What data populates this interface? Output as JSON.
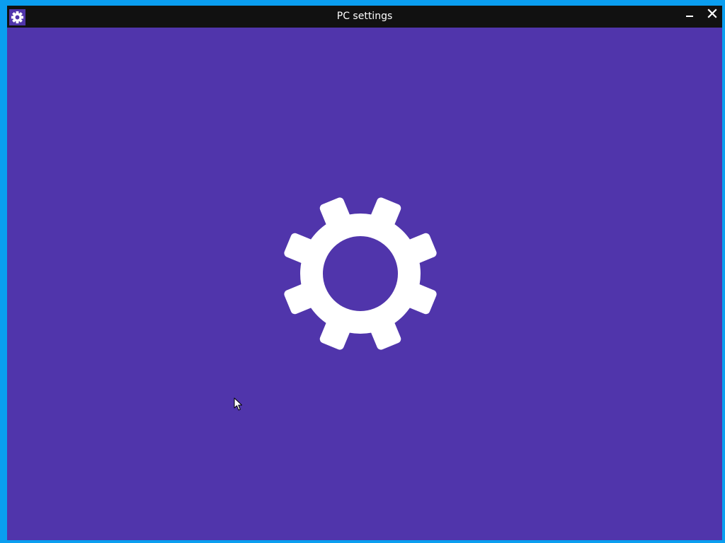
{
  "window": {
    "title": "PC settings",
    "app_icon": "gear-icon",
    "controls": {
      "minimize_icon": "minimize-icon",
      "close_icon": "close-icon"
    }
  },
  "splash": {
    "icon": "gear-icon"
  },
  "colors": {
    "accent": "#5035ab",
    "titlebar": "#111111",
    "desktop": "#0a9ef0",
    "icon": "#ffffff"
  }
}
